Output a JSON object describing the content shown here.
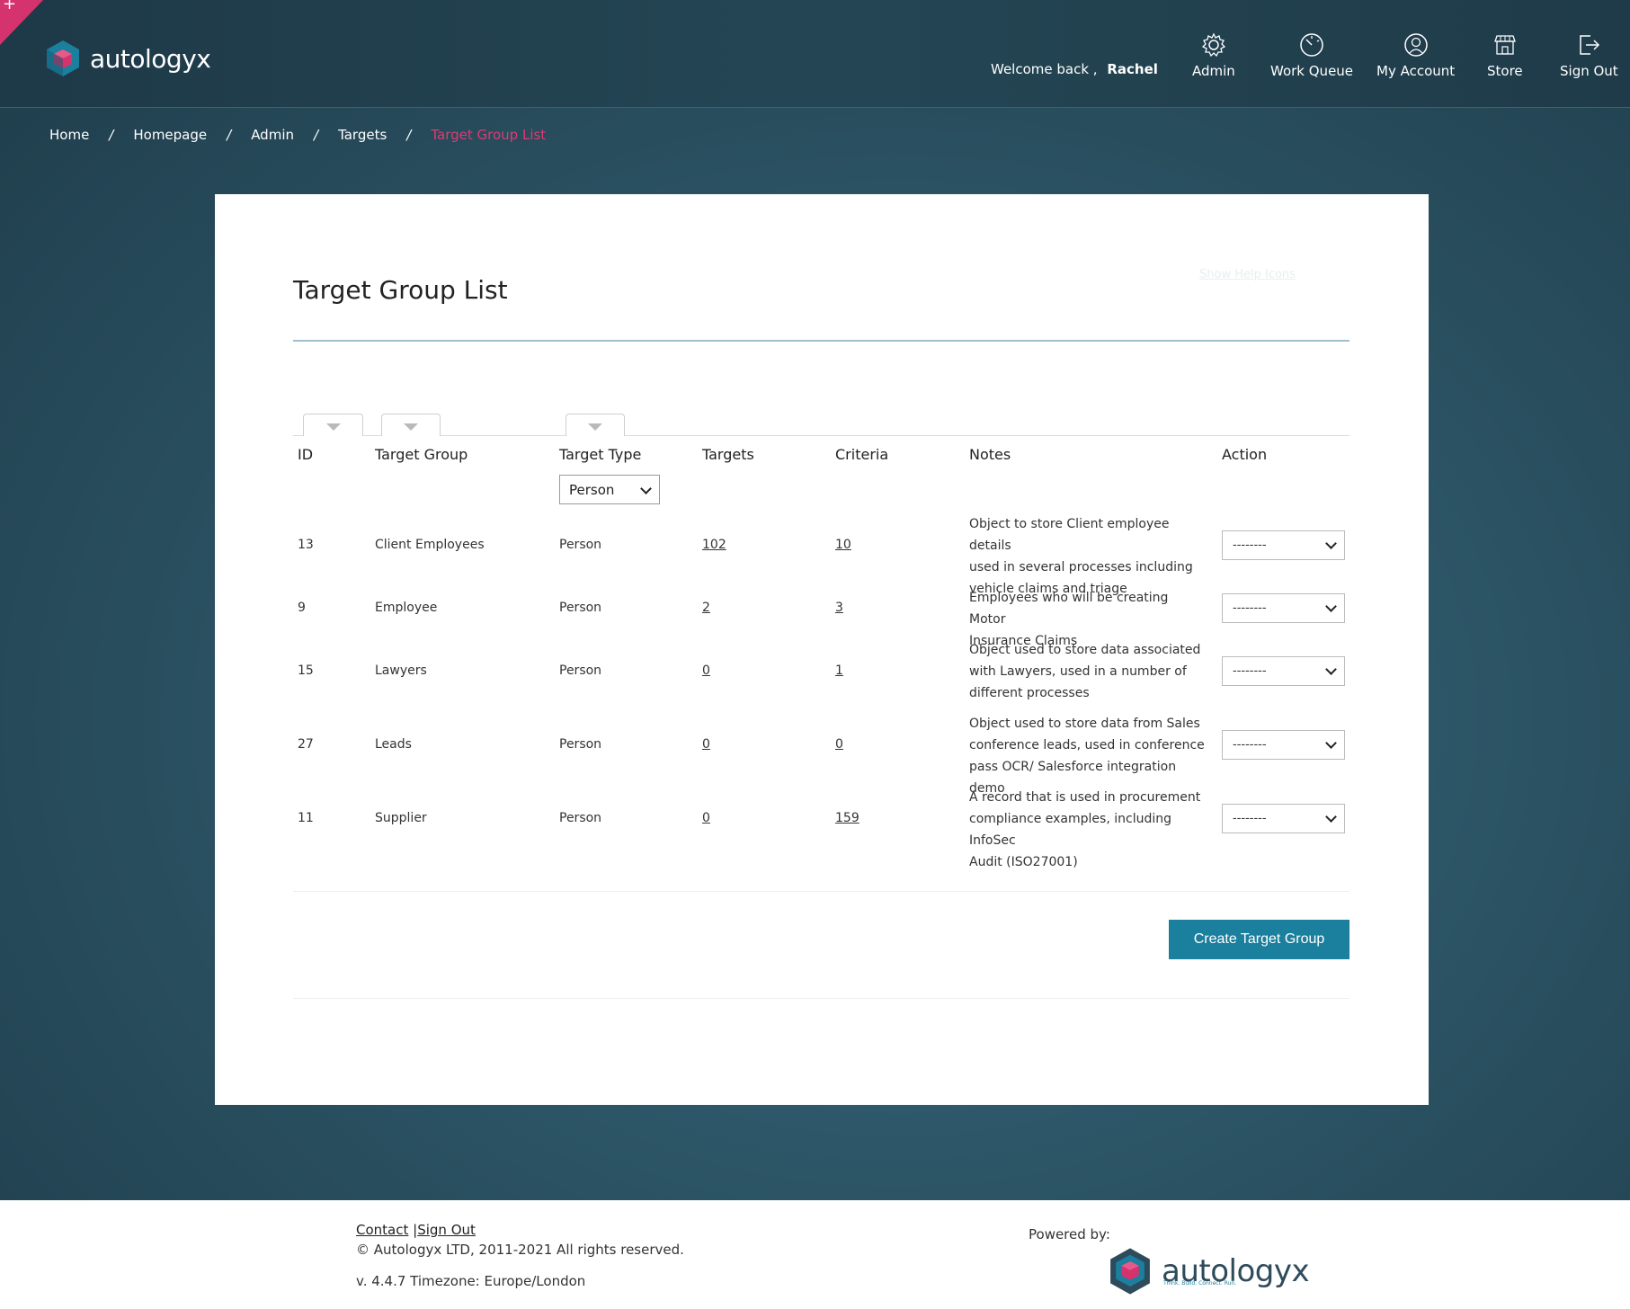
{
  "header": {
    "brand": "autologyx",
    "welcome_prefix": "Welcome back ,",
    "user_name": "Rachel",
    "nav": [
      {
        "label": "Admin",
        "icon": "gear-icon"
      },
      {
        "label": "Work Queue",
        "icon": "gauge-icon"
      },
      {
        "label": "My Account",
        "icon": "user-icon"
      },
      {
        "label": "Store",
        "icon": "store-icon"
      },
      {
        "label": "Sign Out",
        "icon": "sign-out-icon"
      }
    ]
  },
  "breadcrumb": {
    "items": [
      "Home",
      "Homepage",
      "Admin",
      "Targets"
    ],
    "current": "Target Group List",
    "separator": "/"
  },
  "page": {
    "title": "Target Group List",
    "help_link": "Show Help Icons"
  },
  "table": {
    "columns": [
      "ID",
      "Target Group",
      "Target Type",
      "Targets",
      "Criteria",
      "Notes",
      "Action"
    ],
    "type_filter_value": "Person",
    "action_placeholder": "--------",
    "rows": [
      {
        "id": "13",
        "group": "Client Employees",
        "type": "Person",
        "targets": "102",
        "criteria": "10",
        "notes": [
          "Object to store Client employee details",
          "used in several processes including",
          "vehicle claims and triage"
        ]
      },
      {
        "id": "9",
        "group": "Employee",
        "type": "Person",
        "targets": "2",
        "criteria": "3",
        "notes": [
          "Employees who will be creating Motor",
          "Insurance Claims"
        ]
      },
      {
        "id": "15",
        "group": "Lawyers",
        "type": "Person",
        "targets": "0",
        "criteria": "1",
        "notes": [
          "Object used to store data associated",
          "with Lawyers, used in a number of",
          "different processes"
        ]
      },
      {
        "id": "27",
        "group": "Leads",
        "type": "Person",
        "targets": "0",
        "criteria": "0",
        "notes": [
          "Object used to store data from Sales",
          "conference leads, used in conference",
          "pass OCR/ Salesforce integration demo"
        ]
      },
      {
        "id": "11",
        "group": "Supplier",
        "type": "Person",
        "targets": "0",
        "criteria": "159",
        "notes": [
          "A record that is used in procurement",
          "compliance examples, including InfoSec",
          "Audit (ISO27001)"
        ]
      }
    ]
  },
  "actions": {
    "create_label": "Create Target Group"
  },
  "footer": {
    "contact": "Contact",
    "separator": "|",
    "sign_out": "Sign Out",
    "copyright": "© Autologyx LTD, 2011-2021 All rights reserved.",
    "version": "v. 4.4.7 Timezone: Europe/London",
    "powered_by": "Powered by:",
    "brand": "autologyx",
    "tagline": "Think. Build. Connect. Run."
  },
  "colors": {
    "accent_pink": "#e03a73",
    "button_blue": "#1b7f9e",
    "header_bg": "#1e3947"
  }
}
